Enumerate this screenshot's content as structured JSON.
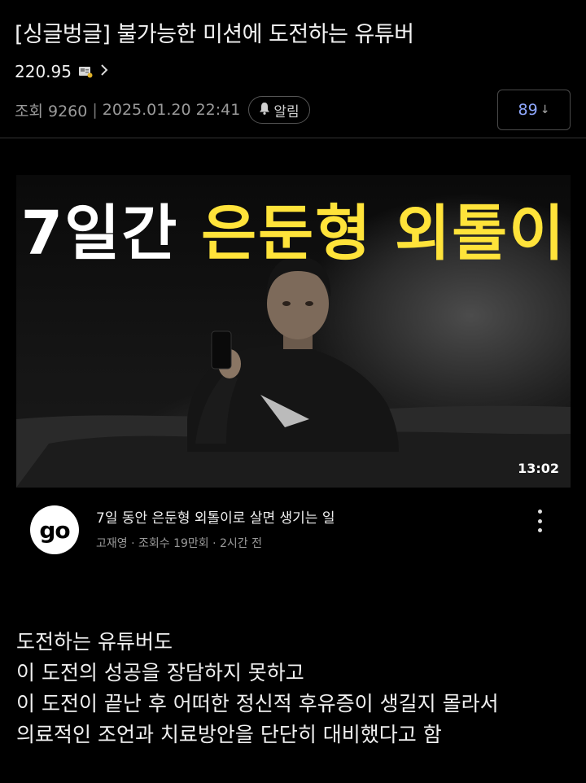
{
  "post": {
    "title": "[싱글벙글] 불가능한 미션에 도전하는 유튜버",
    "author": "220.95",
    "views": "조회 9260",
    "date": "2025.01.20 22:41",
    "alarm_label": "알림",
    "comment_count": "89",
    "comment_arrow": "↓"
  },
  "thumbnail": {
    "headline_white": "7일간",
    "headline_yellow": "은둔형 외톨이",
    "duration": "13:02"
  },
  "video": {
    "channel_logo": "go",
    "title": "7일 동안 은둔형 외톨이로 살면 생기는 일",
    "meta": "고재영 · 조회수 19만회 · 2시간 전"
  },
  "body": {
    "lines": [
      "도전하는 유튜버도",
      "이 도전의 성공을 장담하지 못하고",
      "이 도전이 끝난 후 어떠한 정신적 후유증이 생길지 몰라서",
      "의료적인 조언과 치료방안을 단단히 대비했다고 함"
    ]
  },
  "icons": {
    "author": "user-badge-icon",
    "chevron": "chevron-right-icon",
    "bell": "bell-icon",
    "kebab": "more-vertical-icon"
  },
  "colors": {
    "background": "#000000",
    "accent_blue": "#8fa8ff",
    "headline_yellow": "#ffe33a"
  }
}
